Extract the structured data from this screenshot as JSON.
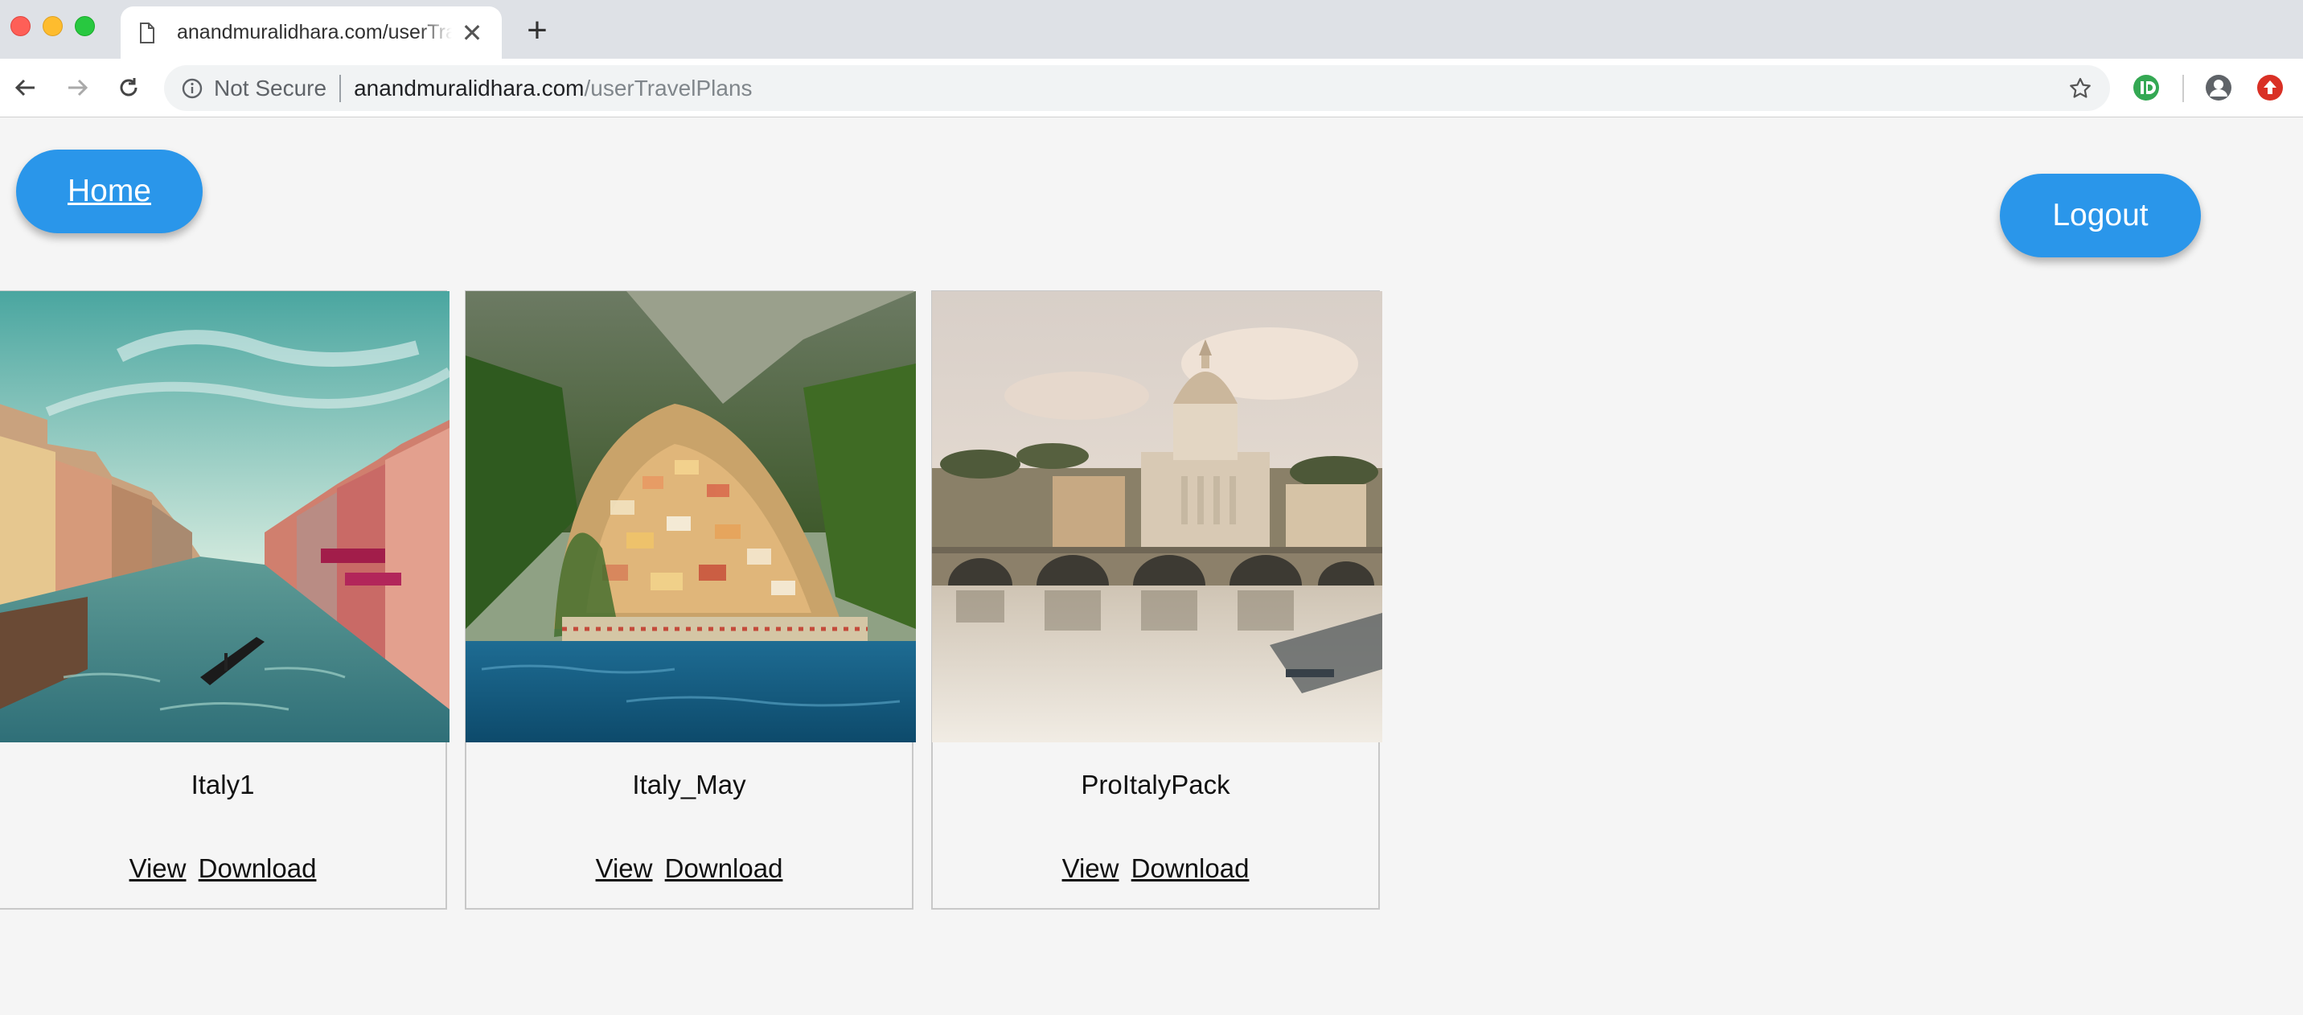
{
  "browser": {
    "tab_title": "anandmuralidhara.com/userTravelPlans",
    "new_tab_symbol": "+",
    "close_symbol": "✕",
    "security_label": "Not Secure",
    "url_host": "anandmuralidhara.com",
    "url_path": "/userTravelPlans"
  },
  "header": {
    "home_label": "Home",
    "logout_label": "Logout",
    "accent_color": "#2a96ea"
  },
  "plans": [
    {
      "name": "Italy1",
      "view_label": "View",
      "download_label": "Download",
      "image": "venice-grand-canal"
    },
    {
      "name": "Italy_May",
      "view_label": "View",
      "download_label": "Download",
      "image": "positano-coast"
    },
    {
      "name": "ProItalyPack",
      "view_label": "View",
      "download_label": "Download",
      "image": "rome-st-peters-bridge"
    }
  ]
}
